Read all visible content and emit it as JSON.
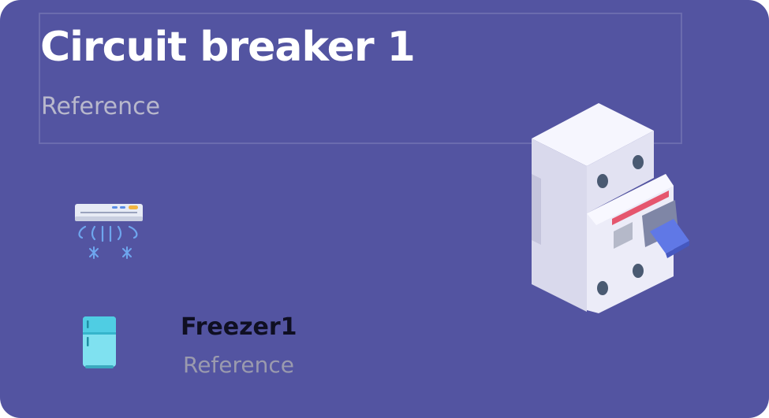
{
  "card": {
    "title": "Circuit breaker 1",
    "subtitle": "Reference",
    "background_color": "#5354a1"
  },
  "devices": [
    {
      "icon": "air-conditioner-icon",
      "name": "",
      "subtitle": ""
    },
    {
      "icon": "fridge-icon",
      "name": "Freezer1",
      "subtitle": "Reference"
    }
  ],
  "illustration": {
    "icon": "circuit-breaker-icon"
  }
}
